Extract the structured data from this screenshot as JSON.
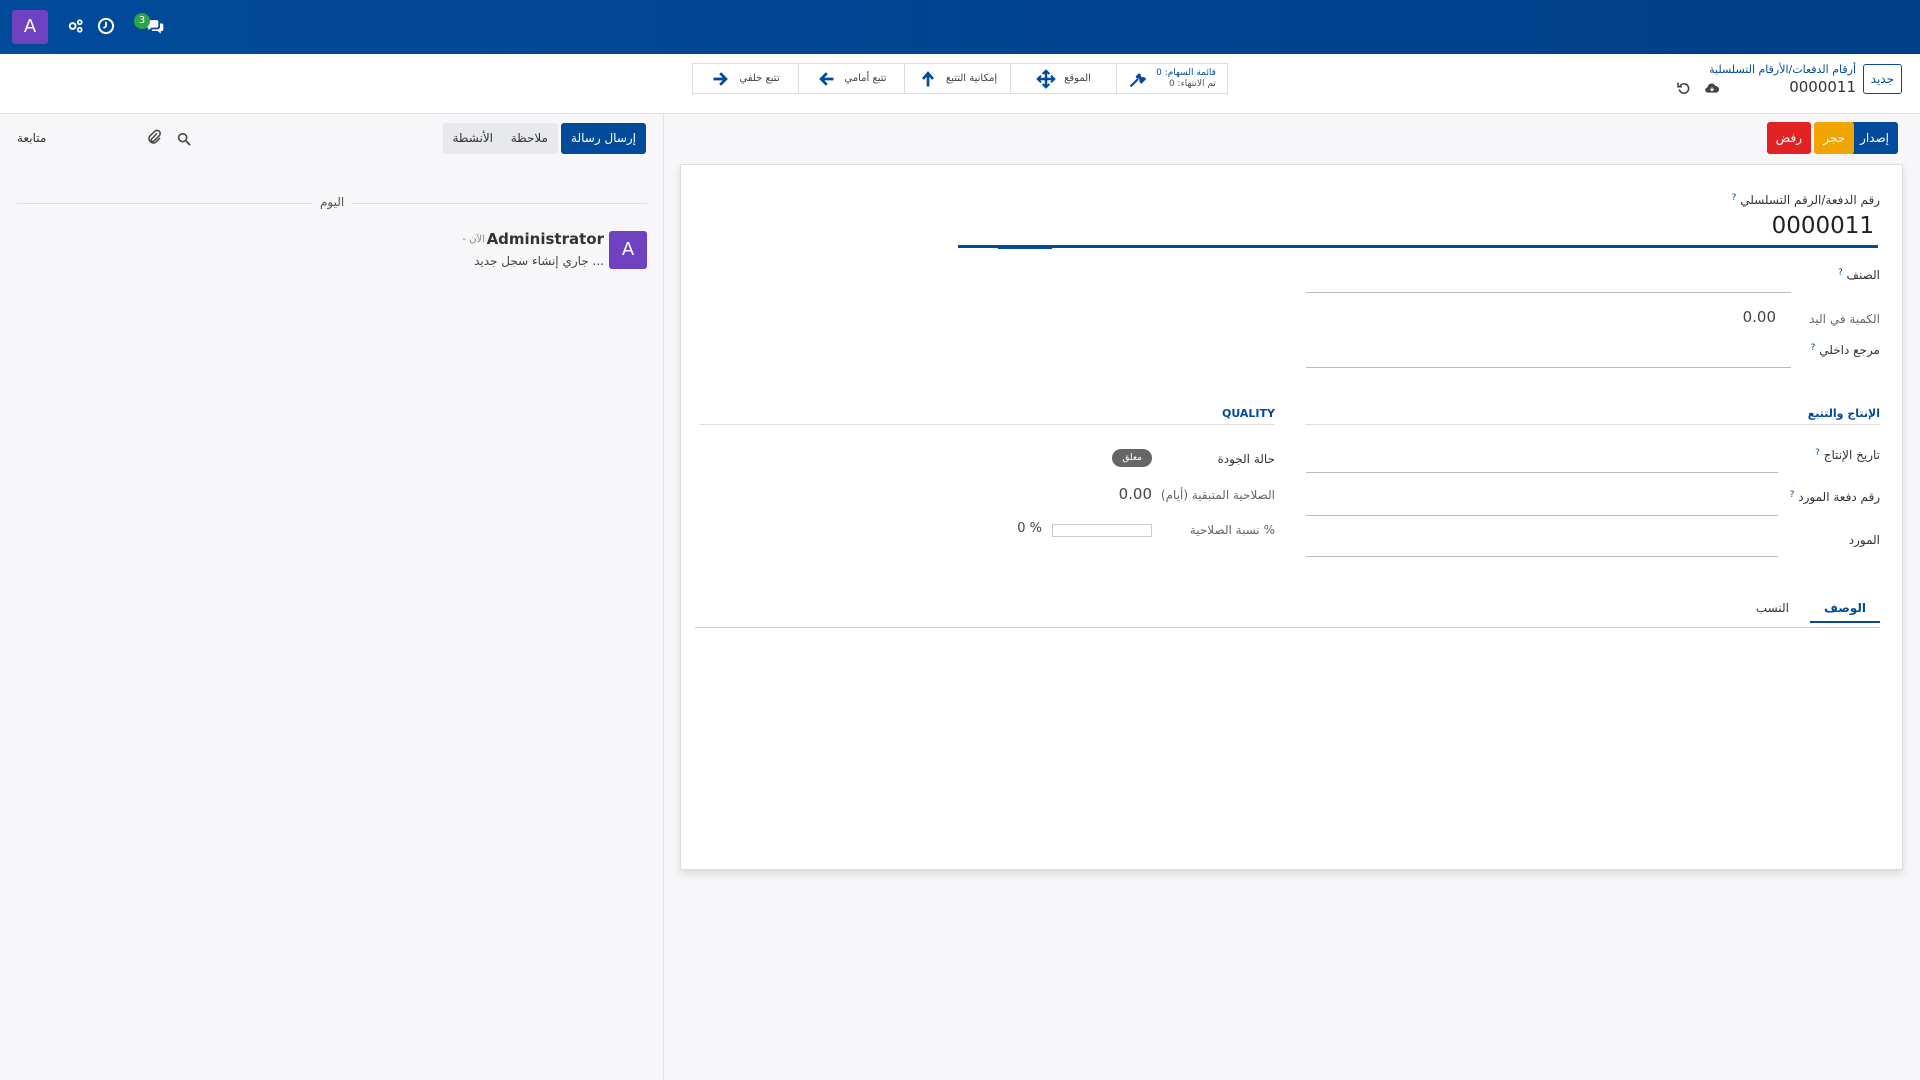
{
  "navbar": {
    "avatar_letter": "A",
    "messages_badge": "3",
    "icons": [
      "chat-icon",
      "clock-icon",
      "settings-icon"
    ]
  },
  "control": {
    "new_button": "جديد",
    "breadcrumb_parent": "أرقام الدفعات/الأرقام التسلسلية",
    "breadcrumb_current": "0000011",
    "smart_buttons": {
      "stock_moves_label": "قائمة السهام: 0",
      "completed_label": "تم الانتهاء: 0",
      "location": "الموقع",
      "traceability": "إمكانية التتبع",
      "forward_trace": "تتبع أمامي",
      "backward_trace": "تتبع خلفي"
    }
  },
  "status": {
    "issue": "إصدار",
    "block": "حجر",
    "reject": "رفض"
  },
  "form": {
    "lot_label": "رقم الدفعة/الرقم التسلسلي",
    "lot_value": "0000011",
    "product_label": "الصنف",
    "on_hand_label": "الكمية في اليد",
    "on_hand_value": "0.00",
    "internal_ref_label": "مرجع داخلي",
    "production_section": "الإنتاج والتتبع",
    "quality_section": "QUALITY",
    "production_date_label": "تاريخ الإنتاج",
    "vendor_lot_label": "رقم دفعة المورد",
    "vendor_label": "المورد",
    "quality_state_label": "حالة الجودة",
    "quality_state_badge": "معلق",
    "remaining_validity_label": "الصلاحية المتبقية (أيام)",
    "remaining_validity_value": "0.00",
    "validity_pct_label": "نسبة الصلاحية %",
    "validity_pct_value": "0 %",
    "validity_progress": 0,
    "tabs": [
      "الوصف",
      "النسب"
    ]
  },
  "chatter": {
    "send_message": "إرسال رسالة",
    "log_note": "ملاحظة",
    "activities": "الأنشطة",
    "follow": "متابعة",
    "today": "اليوم",
    "author": "Administrator",
    "time": "- الآن",
    "body": "جاري إنشاء سجل جديد ...",
    "avatar_letter": "A"
  },
  "colors": {
    "primary": "#014b9a",
    "block": "#f0a500",
    "reject": "#e02424",
    "avatar": "#6f42c1",
    "badge": "#28a745"
  }
}
